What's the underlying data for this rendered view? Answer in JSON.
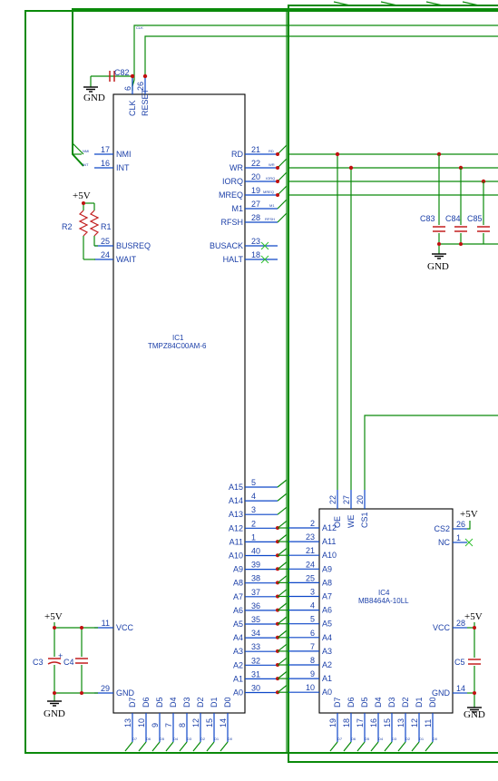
{
  "ic1": {
    "ref": "IC1",
    "part": "TMPZ84C00AM-6",
    "left_pins": [
      {
        "num": "17",
        "name": "NMI"
      },
      {
        "num": "16",
        "name": "INT"
      },
      {
        "num": "25",
        "name": "BUSREQ"
      },
      {
        "num": "24",
        "name": "WAIT"
      },
      {
        "num": "11",
        "name": "VCC"
      },
      {
        "num": "29",
        "name": "GND"
      }
    ],
    "top_pins": [
      {
        "num": "6",
        "name": "CLK"
      },
      {
        "num": "26",
        "name": "RESET"
      }
    ],
    "right_pins": [
      {
        "num": "21",
        "name": "RD"
      },
      {
        "num": "22",
        "name": "WR"
      },
      {
        "num": "20",
        "name": "IORQ"
      },
      {
        "num": "19",
        "name": "MREQ"
      },
      {
        "num": "27",
        "name": "M1"
      },
      {
        "num": "28",
        "name": "RFSH"
      },
      {
        "num": "23",
        "name": "BUSACK"
      },
      {
        "num": "18",
        "name": "HALT"
      }
    ],
    "addr_pins": [
      {
        "num": "5",
        "name": "A15"
      },
      {
        "num": "4",
        "name": "A14"
      },
      {
        "num": "3",
        "name": "A13"
      },
      {
        "num": "2",
        "name": "A12"
      },
      {
        "num": "1",
        "name": "A11"
      },
      {
        "num": "40",
        "name": "A10"
      },
      {
        "num": "39",
        "name": "A9"
      },
      {
        "num": "38",
        "name": "A8"
      },
      {
        "num": "37",
        "name": "A7"
      },
      {
        "num": "36",
        "name": "A6"
      },
      {
        "num": "35",
        "name": "A5"
      },
      {
        "num": "34",
        "name": "A4"
      },
      {
        "num": "33",
        "name": "A3"
      },
      {
        "num": "32",
        "name": "A2"
      },
      {
        "num": "31",
        "name": "A1"
      },
      {
        "num": "30",
        "name": "A0"
      }
    ],
    "data_pins": [
      {
        "num": "13",
        "name": "D7"
      },
      {
        "num": "10",
        "name": "D6"
      },
      {
        "num": "9",
        "name": "D5"
      },
      {
        "num": "7",
        "name": "D4"
      },
      {
        "num": "8",
        "name": "D3"
      },
      {
        "num": "12",
        "name": "D2"
      },
      {
        "num": "15",
        "name": "D1"
      },
      {
        "num": "14",
        "name": "D0"
      }
    ]
  },
  "ic4": {
    "ref": "IC4",
    "part": "MB8464A-10LL",
    "top_pins": [
      {
        "num": "22",
        "name": "OE"
      },
      {
        "num": "27",
        "name": "WE"
      },
      {
        "num": "20",
        "name": "CS1"
      }
    ],
    "addr_pins": [
      {
        "num": "2",
        "name": "A12"
      },
      {
        "num": "23",
        "name": "A11"
      },
      {
        "num": "21",
        "name": "A10"
      },
      {
        "num": "24",
        "name": "A9"
      },
      {
        "num": "25",
        "name": "A8"
      },
      {
        "num": "3",
        "name": "A7"
      },
      {
        "num": "4",
        "name": "A6"
      },
      {
        "num": "5",
        "name": "A5"
      },
      {
        "num": "6",
        "name": "A4"
      },
      {
        "num": "7",
        "name": "A3"
      },
      {
        "num": "8",
        "name": "A2"
      },
      {
        "num": "9",
        "name": "A1"
      },
      {
        "num": "10",
        "name": "A0"
      }
    ],
    "right_pins": [
      {
        "num": "26",
        "name": "CS2"
      },
      {
        "num": "1",
        "name": "NC"
      },
      {
        "num": "28",
        "name": "VCC"
      },
      {
        "num": "14",
        "name": "GND"
      }
    ],
    "data_pins": [
      {
        "num": "19",
        "name": "D7"
      },
      {
        "num": "18",
        "name": "D6"
      },
      {
        "num": "17",
        "name": "D5"
      },
      {
        "num": "16",
        "name": "D4"
      },
      {
        "num": "15",
        "name": "D3"
      },
      {
        "num": "13",
        "name": "D2"
      },
      {
        "num": "12",
        "name": "D1"
      },
      {
        "num": "11",
        "name": "D0"
      }
    ]
  },
  "passives": {
    "c82": "C82",
    "c83": "C83",
    "c84": "C84",
    "c85": "C85",
    "c3": "C3",
    "c4": "C4",
    "c5": "C5",
    "r1": "R1",
    "r2": "R2"
  },
  "power": {
    "gnd": "GND",
    "vcc": "+5V"
  },
  "net_labels": {
    "clk": "CLK",
    "nmi": "NMI",
    "int": "INT",
    "rd": "RD",
    "wr": "WR",
    "iorq": "IORQ",
    "mreq": "MREQ",
    "m1": "M1",
    "rfsh": "RFSH",
    "data": [
      "D7",
      "D6",
      "D5",
      "D4",
      "D3",
      "D2",
      "D1",
      "D0"
    ]
  },
  "colors": {
    "wire": "#0a8a0a",
    "pin": "#0d47c8",
    "passive": "#c21d1d",
    "junction": "#c01010",
    "no_connect": "#2fbf2f"
  }
}
